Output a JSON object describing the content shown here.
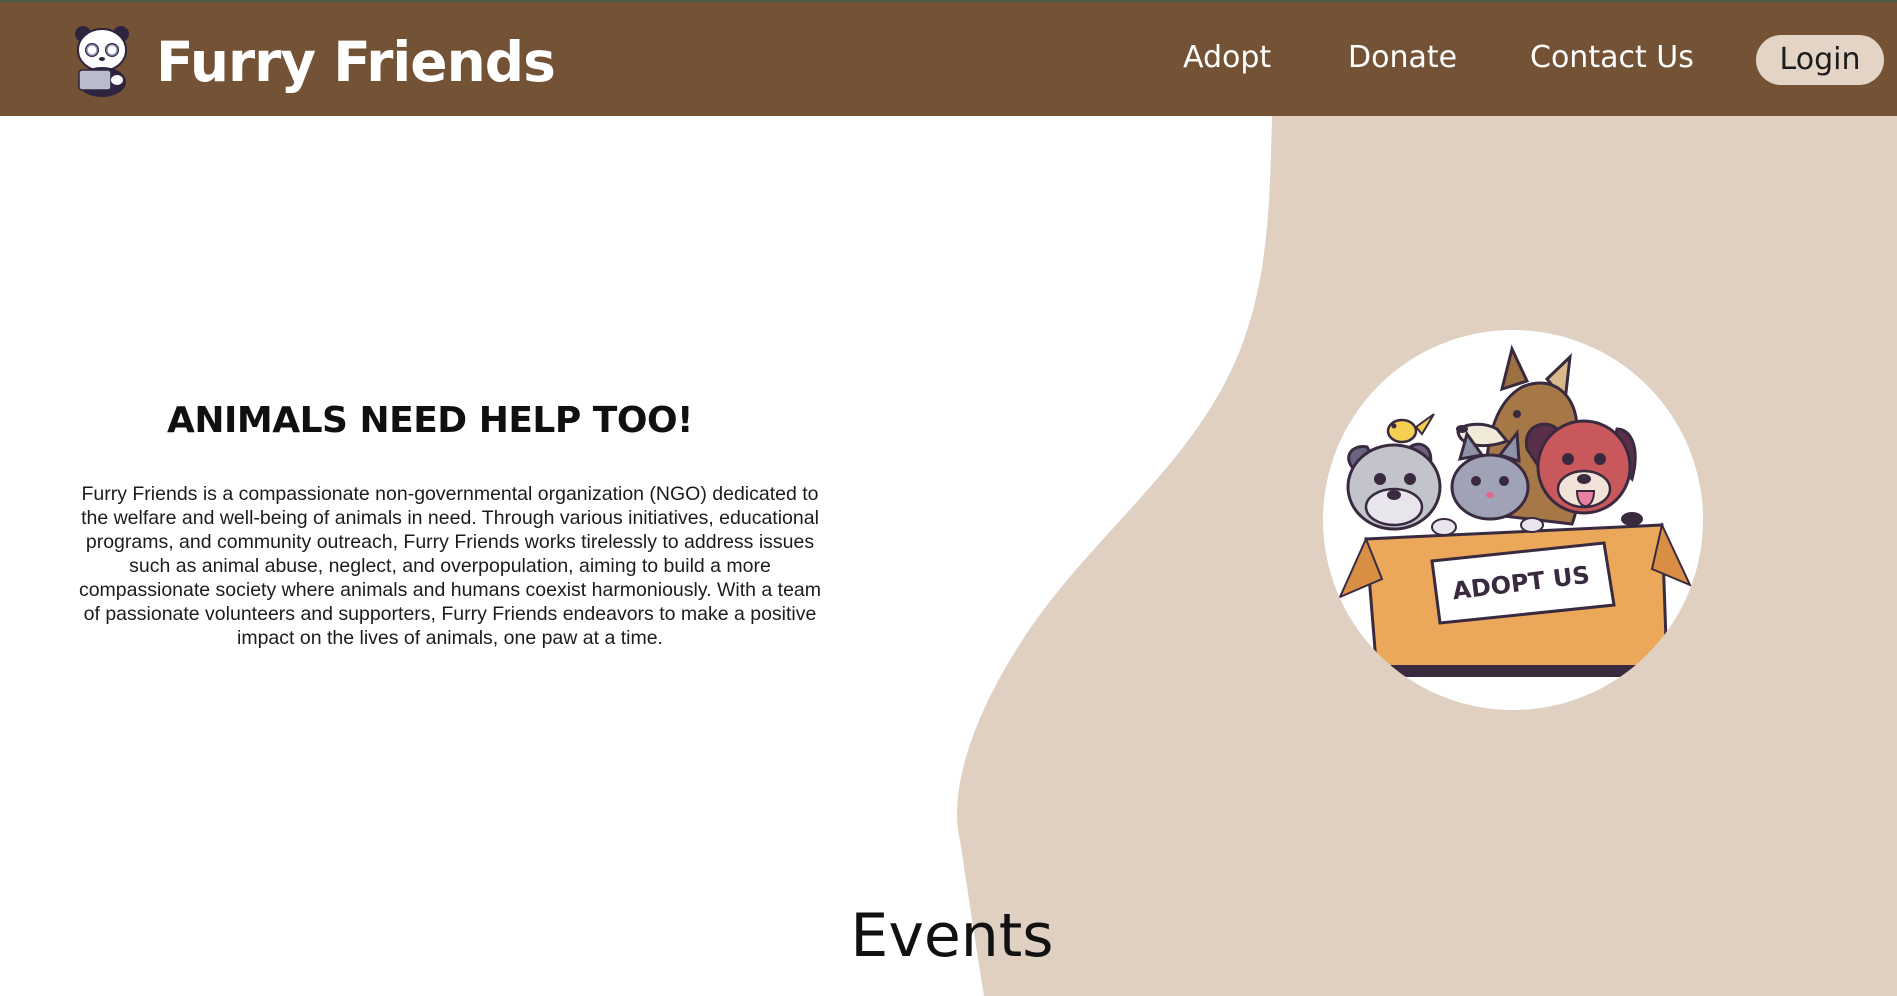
{
  "navbar": {
    "brand": "Furry Friends",
    "links": {
      "adopt": "Adopt",
      "donate": "Donate",
      "contact": "Contact Us"
    },
    "login_label": "Login"
  },
  "hero": {
    "title": "ANIMALS NEED HELP TOO!",
    "description": "Furry Friends is a compassionate non-governmental organization (NGO) dedicated to the welfare and well-being of animals in need. Through various initiatives, educational programs, and community outreach, Furry Friends works tirelessly to address issues such as animal abuse, neglect, and overpopulation, aiming to build a more compassionate society where animals and humans coexist harmoniously. With a team of passionate volunteers and supporters, Furry Friends endeavors to make a positive impact on the lives of animals, one paw at a time.",
    "image_badge": "ADOPT US"
  },
  "events": {
    "title": "Events"
  },
  "colors": {
    "navbar_bg": "#735235",
    "accent_beige": "#e0d0c1",
    "login_bg": "#e3d4c5"
  },
  "icons": {
    "logo": "panda-logo-icon"
  }
}
